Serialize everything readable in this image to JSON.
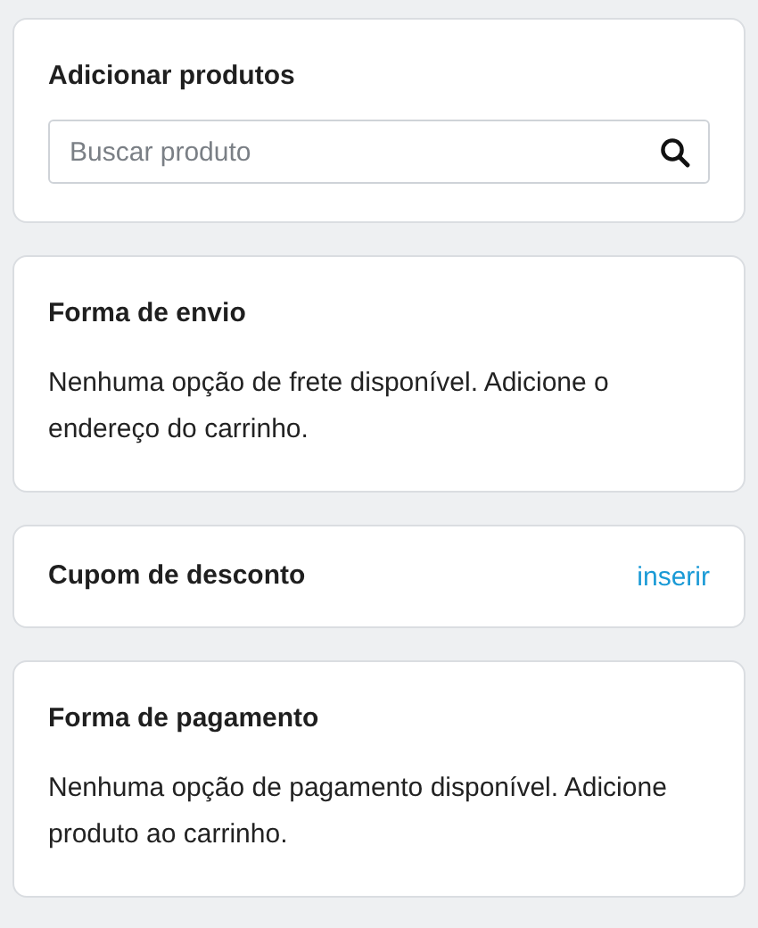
{
  "sections": [
    {
      "kind": "search",
      "title": "Adicionar produtos",
      "placeholder": "Buscar produto"
    },
    {
      "kind": "text",
      "title": "Forma de envio",
      "text": "Nenhuma opção de frete disponível. Adicione o endereço do carrinho."
    },
    {
      "kind": "link",
      "title": "Cupom de desconto",
      "link": "inserir"
    },
    {
      "kind": "text",
      "title": "Forma de pagamento",
      "text": "Nenhuma opção de pagamento disponível. Adicione produto ao carrinho."
    }
  ]
}
